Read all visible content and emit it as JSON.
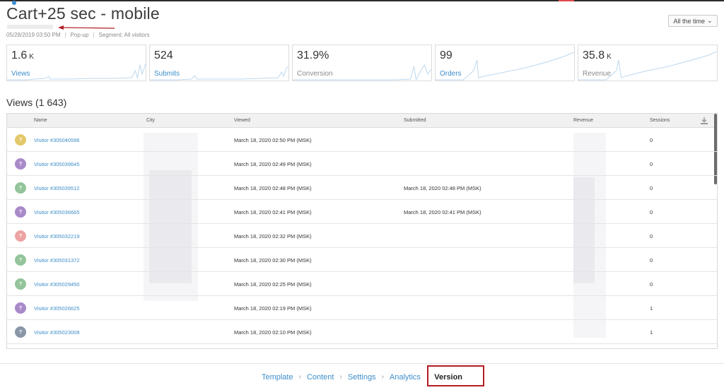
{
  "header": {
    "title": "Cart+25 sec - mobile",
    "date": "05/28/2019 03:50 PM",
    "type": "Pop-up",
    "segment": "Segment: All visitors",
    "period_select": "All the time"
  },
  "stats": [
    {
      "value": "1.6",
      "unit": "K",
      "label": "Views",
      "link": true
    },
    {
      "value": "524",
      "unit": "",
      "label": "Submits",
      "link": true
    },
    {
      "value": "31.9%",
      "unit": "",
      "label": "Conversion",
      "link": false
    },
    {
      "value": "99",
      "unit": "",
      "label": "Orders",
      "link": true
    },
    {
      "value": "35.8",
      "unit": "K",
      "label": "Revenue",
      "link": false
    }
  ],
  "views": {
    "title": "Views (1 643)",
    "columns": {
      "name": "Name",
      "city": "City",
      "viewed": "Viewed",
      "submitted": "Submitted",
      "revenue": "Revenue",
      "sessions": "Sessions"
    },
    "rows": [
      {
        "name": "Visitor #305040596",
        "viewed": "March 18, 2020 02:50 PM (MSK)",
        "submitted": "",
        "sessions": "0",
        "color": "#e3c96b"
      },
      {
        "name": "Visitor #305039645",
        "viewed": "March 18, 2020 02:49 PM (MSK)",
        "submitted": "",
        "sessions": "0",
        "color": "#a98ac9"
      },
      {
        "name": "Visitor #305039512",
        "viewed": "March 18, 2020 02:48 PM (MSK)",
        "submitted": "March 18, 2020 02:48 PM (MSK)",
        "sessions": "0",
        "color": "#93c49a"
      },
      {
        "name": "Visitor #305036665",
        "viewed": "March 18, 2020 02:41 PM (MSK)",
        "submitted": "March 18, 2020 02:41 PM (MSK)",
        "sessions": "0",
        "color": "#a98ac9"
      },
      {
        "name": "Visitor #305032219",
        "viewed": "March 18, 2020 02:32 PM (MSK)",
        "submitted": "",
        "sessions": "0",
        "color": "#eea3a3"
      },
      {
        "name": "Visitor #305031372",
        "viewed": "March 18, 2020 02:30 PM (MSK)",
        "submitted": "",
        "sessions": "0",
        "color": "#93c49a"
      },
      {
        "name": "Visitor #305029450",
        "viewed": "March 18, 2020 02:25 PM (MSK)",
        "submitted": "",
        "sessions": "0",
        "color": "#93c49a"
      },
      {
        "name": "Visitor #305026625",
        "viewed": "March 18, 2020 02:19 PM (MSK)",
        "submitted": "",
        "sessions": "1",
        "color": "#a98ac9"
      },
      {
        "name": "Visitor #305023008",
        "viewed": "March 18, 2020 02:10 PM (MSK)",
        "submitted": "",
        "sessions": "1",
        "color": "#8a96a8"
      }
    ],
    "avatar_glyph": "?"
  },
  "footer": {
    "steps": [
      "Template",
      "Content",
      "Settings",
      "Analytics",
      "Version"
    ],
    "active": "Version",
    "separator": "›"
  },
  "colors": {
    "accent": "#3d8ec9",
    "highlight": "#b21e24"
  }
}
